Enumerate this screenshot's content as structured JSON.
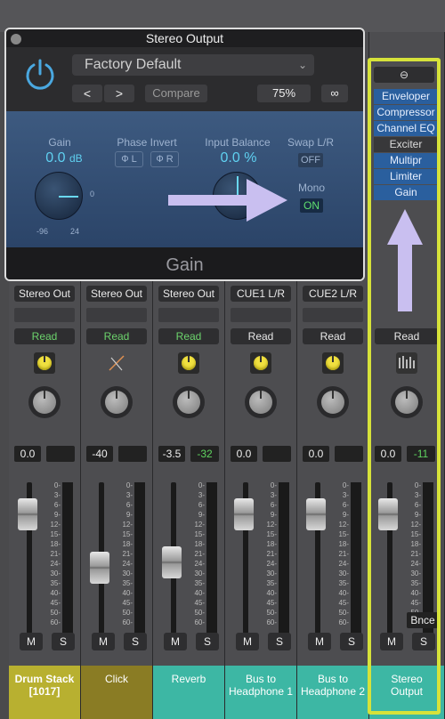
{
  "plugin": {
    "title": "Stereo Output",
    "preset": "Factory Default",
    "prev": "<",
    "next": ">",
    "compare": "Compare",
    "zoom": "75%",
    "gain_label": "Gain",
    "gain_value": "0.0",
    "gain_unit": "dB",
    "gain_min": "-96",
    "gain_max": "24",
    "gain_zero": "0",
    "phase_label": "Phase Invert",
    "phase_l": "Ф L",
    "phase_r": "Ф R",
    "balance_label": "Input Balance",
    "balance_value": "0.0 %",
    "swap_label": "Swap L/R",
    "swap_value": "OFF",
    "mono_label": "Mono",
    "mono_value": "ON",
    "footer": "Gain"
  },
  "inserts": [
    "Enveloper",
    "Compressor",
    "Channel EQ",
    "Exciter",
    "Multipr",
    "Limiter",
    "Gain"
  ],
  "strips": [
    {
      "output": "Stereo Out",
      "read": "Read",
      "val1": "0.0",
      "val2": "",
      "name": "Drum Stack\n[1017]",
      "color": "#b8b030",
      "m": "M",
      "s": "S"
    },
    {
      "output": "Stereo Out",
      "read": "Read",
      "val1": "-40",
      "val2": "",
      "name": "Click",
      "color": "#8a7c24",
      "m": "M",
      "s": "S"
    },
    {
      "output": "Stereo Out",
      "read": "Read",
      "val1": "-3.5",
      "val2": "-32",
      "name": "Reverb",
      "color": "#3db7a4",
      "m": "M",
      "s": "S"
    },
    {
      "output": "CUE1 L/R",
      "read": "Read",
      "val1": "0.0",
      "val2": "",
      "name": "Bus to\nHeadphone 1",
      "color": "#3db7a4",
      "m": "M",
      "s": "S"
    },
    {
      "output": "CUE2 L/R",
      "read": "Read",
      "val1": "0.0",
      "val2": "",
      "name": "Bus to\nHeadphone 2",
      "color": "#3db7a4",
      "m": "M",
      "s": "S"
    },
    {
      "output": "",
      "read": "Read",
      "val1": "0.0",
      "val2": "-11",
      "name": "Stereo\nOutput",
      "color": "#3db7a4",
      "m": "M",
      "s": "S"
    }
  ],
  "bnce": "Bnce",
  "scale": [
    "0",
    "3",
    "6",
    "9",
    "12",
    "15",
    "18",
    "21",
    "24",
    "30",
    "35",
    "40",
    "45",
    "50",
    "60"
  ],
  "scale_bottom": [
    "10",
    "15",
    "20",
    "30"
  ]
}
